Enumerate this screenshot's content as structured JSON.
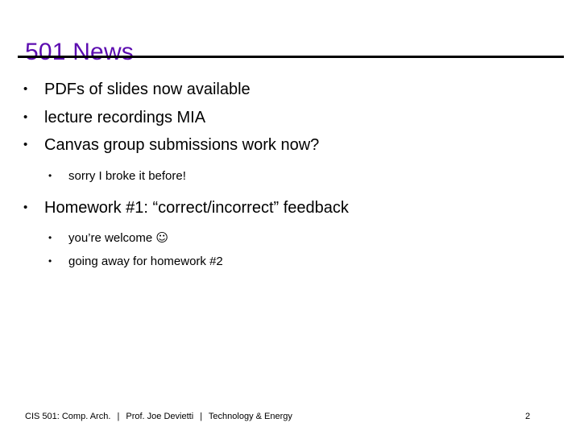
{
  "slide": {
    "title": "501 News",
    "title_color": "#5C0DB0",
    "rule_color": "#000000",
    "background_color": "#FFFFFF",
    "text_color": "#000000"
  },
  "bullets": [
    {
      "level": 1,
      "marker": "•",
      "text": "PDFs of slides now available"
    },
    {
      "level": 1,
      "marker": "•",
      "text": "lecture recordings MIA"
    },
    {
      "level": 1,
      "marker": "•",
      "text": "Canvas group submissions work now?"
    },
    {
      "level": 2,
      "marker": "•",
      "text": "sorry I broke it before!"
    },
    {
      "level": 1,
      "marker": "•",
      "text": "Homework #1: “correct/incorrect” feedback"
    },
    {
      "level": 2,
      "marker": "•",
      "text": "you’re welcome ",
      "emoji": "☺"
    },
    {
      "level": 2,
      "marker": "•",
      "text": "going away for homework #2"
    }
  ],
  "footer": {
    "course": "CIS 501: Comp. Arch.",
    "separator": "|",
    "instructor": "Prof. Joe Devietti",
    "topic": "Technology & Energy",
    "page_number": "2"
  }
}
